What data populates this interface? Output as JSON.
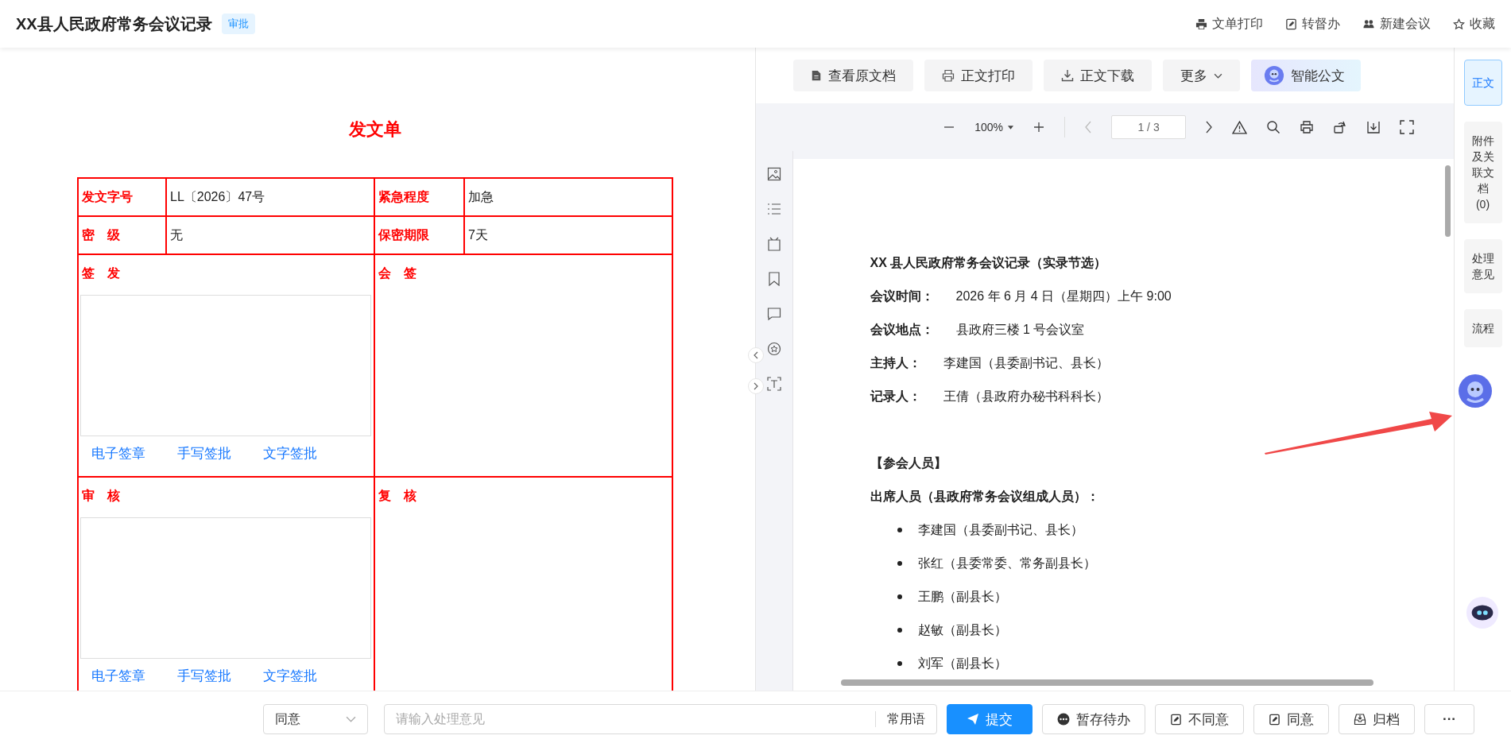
{
  "header": {
    "title": "XX县人民政府常务会议记录",
    "badge": "审批",
    "actions": [
      {
        "label": "文单打印",
        "kind": "print"
      },
      {
        "label": "转督办",
        "kind": "edit"
      },
      {
        "label": "新建会议",
        "kind": "people"
      },
      {
        "label": "收藏",
        "kind": "star"
      }
    ]
  },
  "form": {
    "title": "发文单",
    "rows": [
      [
        {
          "label": "发文字号",
          "value": "LL〔2026〕47号"
        },
        {
          "label": "紧急程度",
          "value": "加急"
        }
      ],
      [
        {
          "label": "密　级",
          "value": "无"
        },
        {
          "label": "保密期限",
          "value": "7天"
        }
      ]
    ],
    "sections": [
      [
        {
          "title": "签　发",
          "kind": "sign",
          "links": [
            "电子签章",
            "手写签批",
            "文字签批"
          ]
        },
        {
          "title": "会　签",
          "kind": "blank"
        }
      ],
      [
        {
          "title": "审　核",
          "kind": "sign",
          "links": [
            "电子签章",
            "手写签批",
            "文字签批"
          ]
        },
        {
          "title": "复　核",
          "kind": "blank"
        }
      ]
    ]
  },
  "doc_toolbar": [
    {
      "label": "查看原文档",
      "kind": "file"
    },
    {
      "label": "正文打印",
      "kind": "print"
    },
    {
      "label": "正文下载",
      "kind": "download"
    },
    {
      "label": "更多",
      "kind": "more"
    },
    {
      "label": "智能公文",
      "kind": "ai"
    }
  ],
  "viewer": {
    "zoom": "100%",
    "page": "1 / 3"
  },
  "document": {
    "lines": [
      {
        "kind": "title",
        "text": "XX 县人民政府常务会议记录（实录节选）"
      },
      {
        "kind": "field",
        "label": "会议时间：",
        "value": "2026 年 6 月 4 日（星期四）上午 9:00"
      },
      {
        "kind": "field",
        "label": "会议地点：",
        "value": "县政府三楼 1 号会议室"
      },
      {
        "kind": "field",
        "label": "主持人：",
        "value": "李建国（县委副书记、县长）"
      },
      {
        "kind": "field",
        "label": "记录人：",
        "value": "王倩（县政府办秘书科科长）"
      },
      {
        "kind": "heading",
        "text": "【参会人员】"
      },
      {
        "kind": "title",
        "text": "出席人员（县政府常务会议组成人员）："
      },
      {
        "kind": "bullet",
        "text": "李建国（县委副书记、县长）"
      },
      {
        "kind": "bullet",
        "text": "张红（县委常委、常务副县长）"
      },
      {
        "kind": "bullet",
        "text": "王鹏（副县长）"
      },
      {
        "kind": "bullet",
        "text": "赵敏（副县长）"
      },
      {
        "kind": "bullet",
        "text": "刘军（副县长）"
      }
    ]
  },
  "side_tabs": [
    {
      "label": "正文",
      "selected": true
    },
    {
      "label": "附件及关联文档",
      "count": "(0)",
      "selected": false
    },
    {
      "label": "处理意见",
      "selected": false
    },
    {
      "label": "流程",
      "selected": false
    }
  ],
  "footer": {
    "opinion": "同意",
    "placeholder": "请输入处理意见",
    "phrases": "常用语",
    "buttons": [
      {
        "label": "提交",
        "kind": "submit"
      },
      {
        "label": "暂存待办",
        "kind": "save"
      },
      {
        "label": "不同意",
        "kind": "edit"
      },
      {
        "label": "同意",
        "kind": "edit"
      },
      {
        "label": "归档",
        "kind": "archive"
      },
      {
        "label": "···",
        "kind": "more"
      }
    ]
  }
}
